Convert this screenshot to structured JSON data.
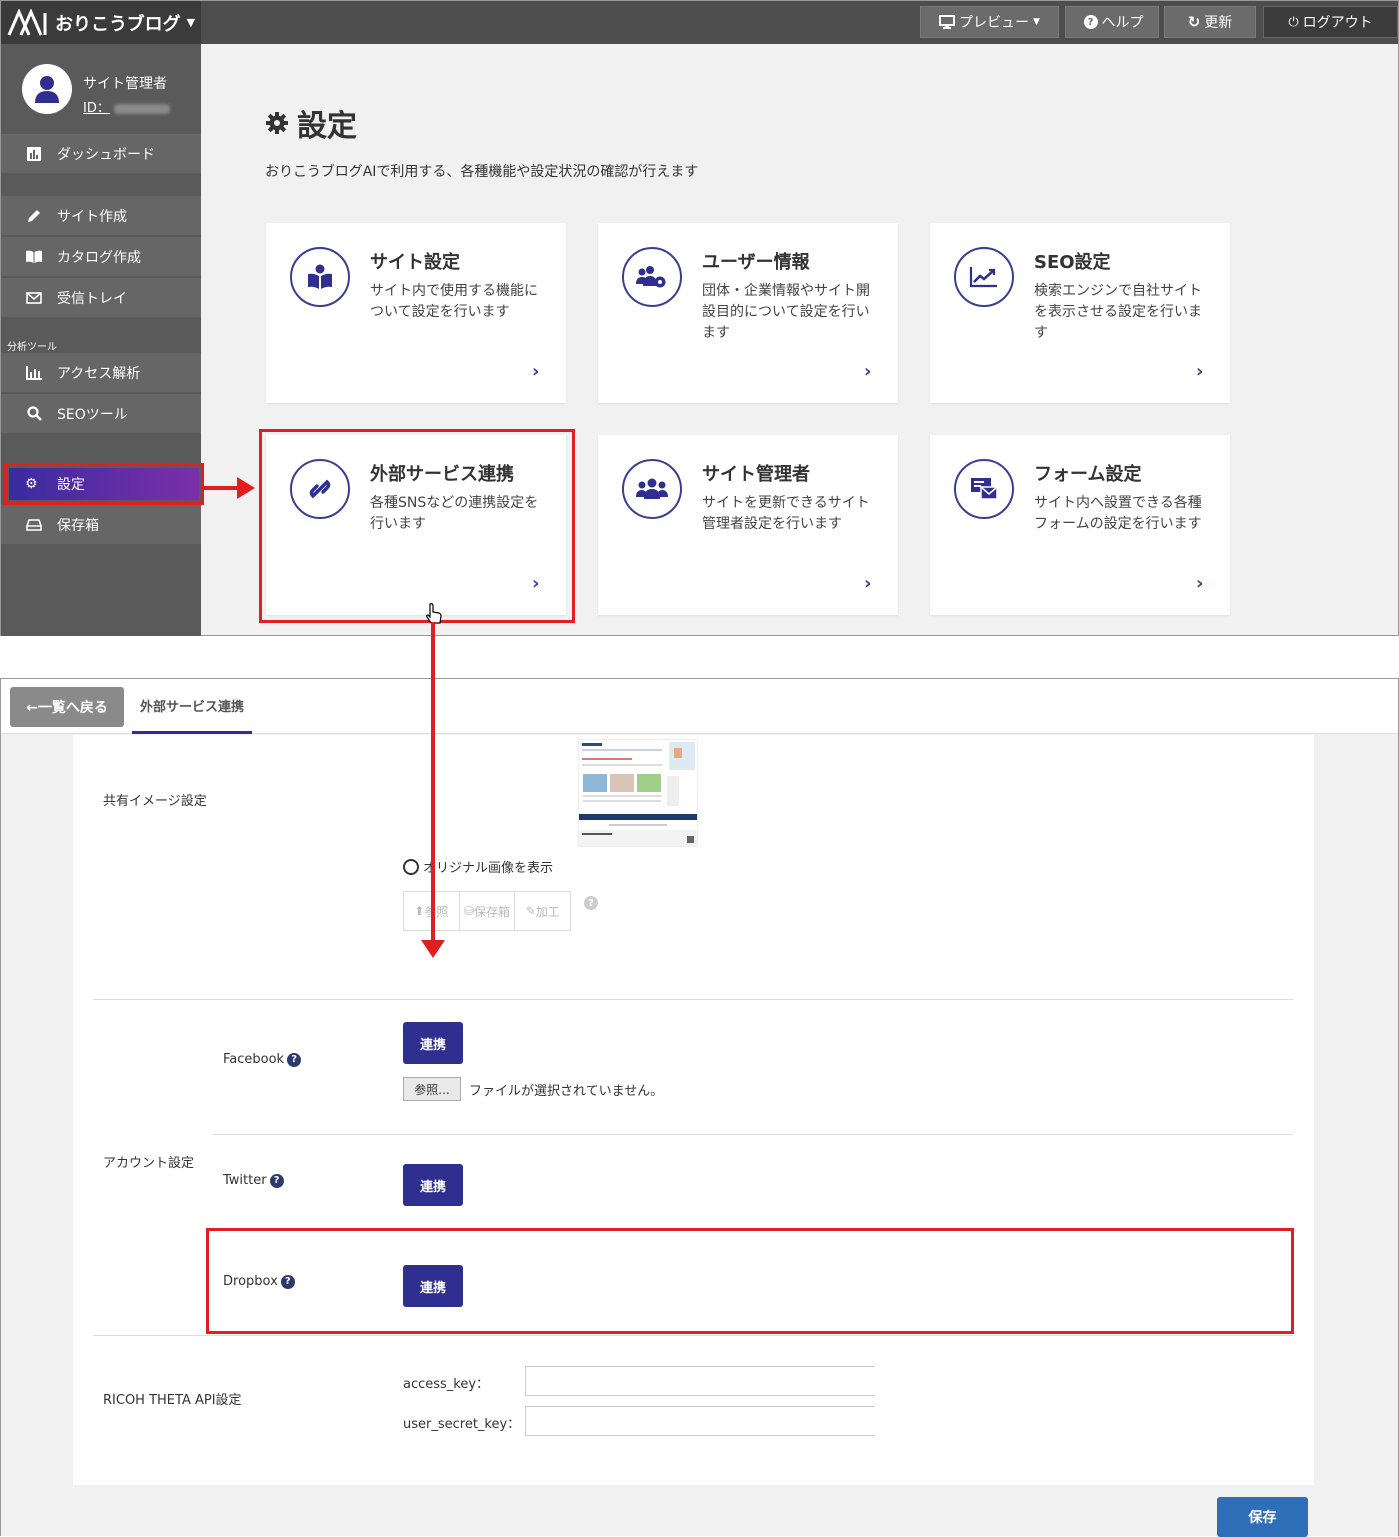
{
  "header": {
    "app_name": "おりこうブログ",
    "preview_label": "プレビュー",
    "help_label": "ヘルプ",
    "refresh_label": "更新",
    "logout_label": "ログアウト"
  },
  "profile": {
    "name": "サイト管理者",
    "id_label": "ID："
  },
  "sidebar": {
    "items": [
      {
        "label": "ダッシュボード",
        "icon": "bar-chart-icon"
      },
      {
        "label": "サイト作成",
        "icon": "pencil-icon"
      },
      {
        "label": "カタログ作成",
        "icon": "book-icon"
      },
      {
        "label": "受信トレイ",
        "icon": "envelope-icon"
      },
      {
        "label": "アクセス解析",
        "icon": "bar-chart-icon"
      },
      {
        "label": "SEOツール",
        "icon": "search-icon"
      },
      {
        "label": "設定",
        "icon": "gear-icon"
      },
      {
        "label": "保存箱",
        "icon": "drive-icon"
      }
    ],
    "group_label": "分析ツール"
  },
  "settings_page": {
    "title": "設定",
    "description": "おりこうブログAIで利用する、各種機能や設定状況の確認が行えます",
    "cards": [
      {
        "title": "サイト設定",
        "desc": "サイト内で使用する機能について設定を行います",
        "icon": "book-reader-icon"
      },
      {
        "title": "ユーザー情報",
        "desc": "団体・企業情報やサイト開設目的について設定を行います",
        "icon": "users-gear-icon"
      },
      {
        "title": "SEO設定",
        "desc": "検索エンジンで自社サイトを表示させる設定を行います",
        "icon": "trend-chart-icon"
      },
      {
        "title": "外部サービス連携",
        "desc": "各種SNSなどの連携設定を行います",
        "icon": "link-icon"
      },
      {
        "title": "サイト管理者",
        "desc": "サイトを更新できるサイト管理者設定を行います",
        "icon": "group-icon"
      },
      {
        "title": "フォーム設定",
        "desc": "サイト内へ設置できる各種フォームの設定を行います",
        "icon": "form-mail-icon"
      }
    ]
  },
  "external_page": {
    "back_label": "←一覧へ戻る",
    "tab_label": "外部サービス連携",
    "share_image_label": "共有イメージ設定",
    "original_image_label": "オリジナル画像を表示",
    "image_buttons": [
      "参照",
      "保存箱",
      "加工"
    ],
    "account_label": "アカウント設定",
    "accounts": [
      {
        "name": "Facebook",
        "button": "連携"
      },
      {
        "name": "Twitter",
        "button": "連携"
      },
      {
        "name": "Dropbox",
        "button": "連携"
      }
    ],
    "file_button": "参照...",
    "file_status": "ファイルが選択されていません。",
    "ricoh_label": "RICOH THETA API設定",
    "access_key_label": "access_key：",
    "user_secret_key_label": "user_secret_key：",
    "save_label": "保存"
  },
  "colors": {
    "accent": "#2e2f8f",
    "highlight": "#e02020",
    "save": "#2f6fba"
  }
}
